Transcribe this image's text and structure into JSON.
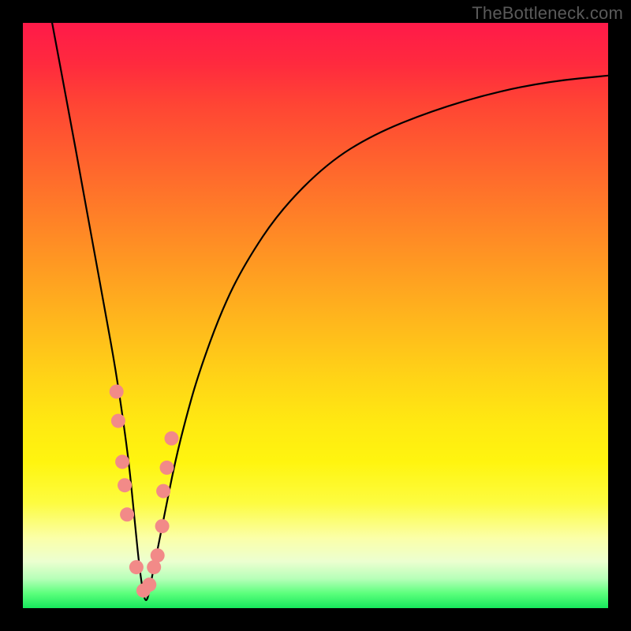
{
  "watermark": "TheBottleneck.com",
  "chart_data": {
    "type": "line",
    "title": "",
    "xlabel": "",
    "ylabel": "",
    "xlim": [
      0,
      100
    ],
    "ylim": [
      0,
      100
    ],
    "grid": false,
    "series": [
      {
        "name": "bottleneck-curve",
        "x": [
          5,
          8,
          10,
          12,
          14,
          16,
          18,
          19,
          20,
          21,
          22,
          24,
          26,
          28,
          30,
          34,
          38,
          44,
          52,
          60,
          70,
          80,
          90,
          100
        ],
        "y": [
          100,
          84,
          73,
          62,
          51,
          40,
          26,
          16,
          6,
          0,
          5,
          15,
          25,
          33,
          40,
          51,
          59,
          68,
          76,
          81,
          85,
          88,
          90,
          91
        ]
      }
    ],
    "markers": {
      "name": "highlight-points",
      "color": "#f28a88",
      "x": [
        16.0,
        16.3,
        17.0,
        17.4,
        17.8,
        19.4,
        20.6,
        21.6,
        22.4,
        23.0,
        23.8,
        24.0,
        24.6,
        25.4
      ],
      "y": [
        37,
        32,
        25,
        21,
        16,
        7,
        3,
        4,
        7,
        9,
        14,
        20,
        24,
        29
      ]
    },
    "gradient_stops": [
      {
        "pos": 0.0,
        "color": "#ff1a49"
      },
      {
        "pos": 0.26,
        "color": "#ff6a2c"
      },
      {
        "pos": 0.5,
        "color": "#ffb41d"
      },
      {
        "pos": 0.75,
        "color": "#fff50f"
      },
      {
        "pos": 0.92,
        "color": "#ecffd0"
      },
      {
        "pos": 1.0,
        "color": "#17e85c"
      }
    ]
  }
}
